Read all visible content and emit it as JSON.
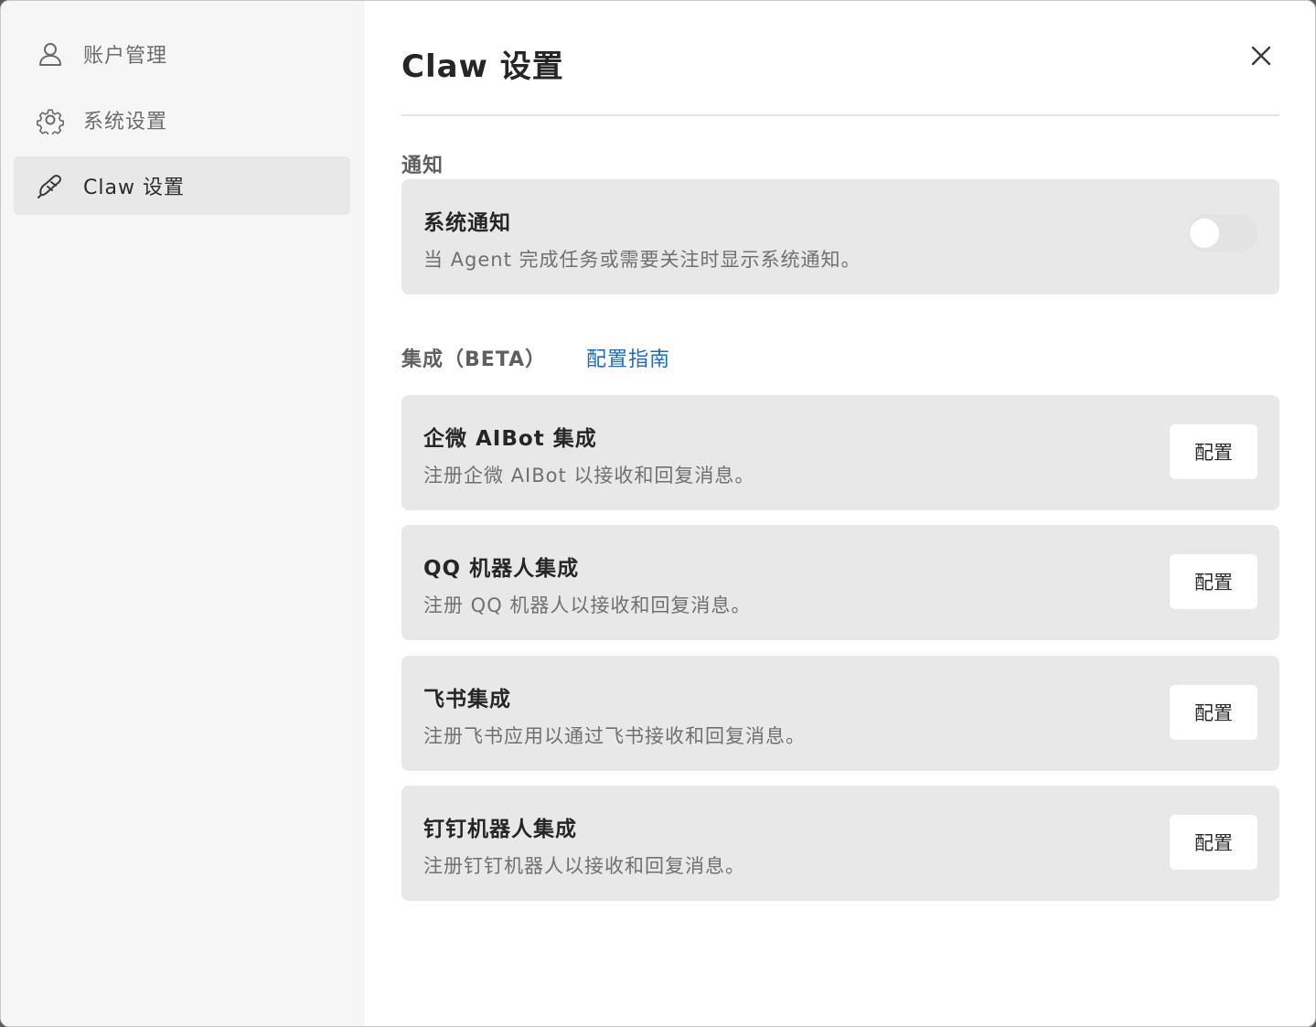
{
  "sidebar": {
    "items": [
      {
        "label": "账户管理",
        "icon": "user-icon",
        "active": false
      },
      {
        "label": "系统设置",
        "icon": "gear-icon",
        "active": false
      },
      {
        "label": "Claw 设置",
        "icon": "claw-icon",
        "active": true
      }
    ]
  },
  "header": {
    "title": "Claw 设置",
    "close_icon": "close-icon"
  },
  "notifications": {
    "section_label": "通知",
    "system": {
      "title": "系统通知",
      "description": "当 Agent 完成任务或需要关注时显示系统通知。",
      "enabled": false
    }
  },
  "integrations": {
    "section_label": "集成（BETA）",
    "guide_link": "配置指南",
    "items": [
      {
        "title": "企微 AIBot 集成",
        "description": "注册企微 AIBot 以接收和回复消息。",
        "button": "配置"
      },
      {
        "title": "QQ 机器人集成",
        "description": "注册 QQ 机器人以接收和回复消息。",
        "button": "配置"
      },
      {
        "title": "飞书集成",
        "description": "注册飞书应用以通过飞书接收和回复消息。",
        "button": "配置"
      },
      {
        "title": "钉钉机器人集成",
        "description": "注册钉钉机器人以接收和回复消息。",
        "button": "配置"
      }
    ]
  },
  "colors": {
    "accent_link": "#1b6cc2",
    "sidebar_bg": "#f6f6f6",
    "card_bg": "#e8e8e8"
  }
}
